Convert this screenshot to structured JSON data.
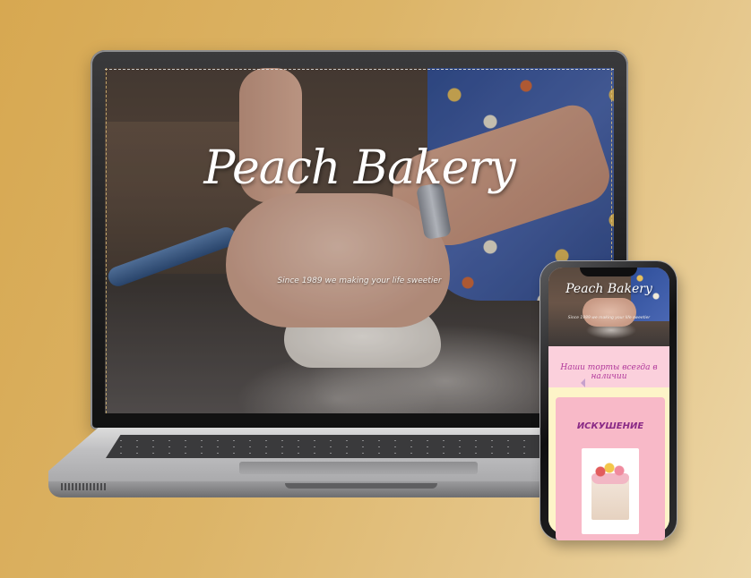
{
  "laptop_site": {
    "title": "Peach Bakery",
    "tagline": "Since 1989 we making your life sweetier"
  },
  "phone_site": {
    "title": "Peach Bakery",
    "tagline": "Since 1989 we making your life sweetier",
    "availability_heading": "Наши торты всегда в наличии",
    "product_card": {
      "title": "ИСКУШЕНИЕ"
    }
  },
  "colors": {
    "background_gradient_start": "#d7a851",
    "background_gradient_end": "#ecd6a6",
    "phone_pink_band": "#fbd0dc",
    "phone_card_pink": "#f8b9c8",
    "phone_cream": "#fdf4c8",
    "accent_purple": "#b0369a"
  },
  "icons": {
    "carousel_prev": "chevron-left-icon"
  }
}
